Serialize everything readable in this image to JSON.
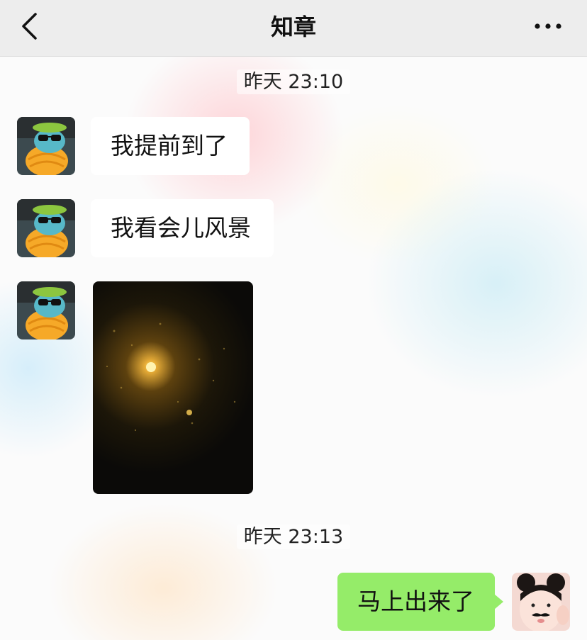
{
  "navbar": {
    "title": "知章",
    "back_icon": "chevron-left-icon",
    "more_icon": "ellipsis-icon"
  },
  "messages": {
    "time1": "昨天 23:10",
    "msg1": "我提前到了",
    "msg2": "我看会儿风景",
    "time2": "昨天 23:13",
    "msg_me": "马上出来了"
  },
  "colors": {
    "navbar_bg": "#ededed",
    "my_bubble": "#95ec69",
    "their_bubble": "#ffffff"
  }
}
